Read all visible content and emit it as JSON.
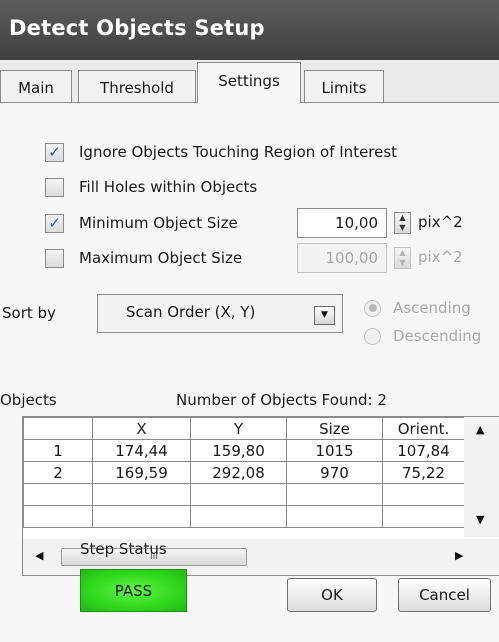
{
  "window": {
    "title": "Detect Objects Setup"
  },
  "tabs": [
    {
      "label": "Main"
    },
    {
      "label": "Threshold"
    },
    {
      "label": "Settings"
    },
    {
      "label": "Limits"
    }
  ],
  "active_tab": "Settings",
  "options": {
    "ignore_touching": {
      "label": "Ignore Objects Touching Region of Interest",
      "checked": true
    },
    "fill_holes": {
      "label": "Fill Holes within Objects",
      "checked": false
    },
    "min_size": {
      "label": "Minimum Object Size",
      "checked": true,
      "value": "10,00",
      "unit": "pix^2"
    },
    "max_size": {
      "label": "Maximum Object Size",
      "checked": false,
      "value": "100,00",
      "unit": "pix^2"
    }
  },
  "sort": {
    "label": "Sort by",
    "selected": "Scan Order (X, Y)",
    "ascending_label": "Ascending",
    "descending_label": "Descending",
    "ascending_selected": true
  },
  "objects": {
    "label": "Objects",
    "found_text": "Number of Objects Found: 2",
    "columns": [
      "",
      "X",
      "Y",
      "Size",
      "Orient."
    ],
    "rows": [
      [
        "1",
        "174,44",
        "159,80",
        "1015",
        "107,84"
      ],
      [
        "2",
        "169,59",
        "292,08",
        "970",
        "75,22"
      ],
      [
        "",
        "",
        "",
        "",
        ""
      ],
      [
        "",
        "",
        "",
        "",
        ""
      ]
    ]
  },
  "scrollbar": {
    "thumb_grip": "III"
  },
  "step_status": {
    "label": "Step Status",
    "value": "PASS",
    "color": "#33dd1e"
  },
  "buttons": {
    "ok": "OK",
    "cancel": "Cancel"
  }
}
